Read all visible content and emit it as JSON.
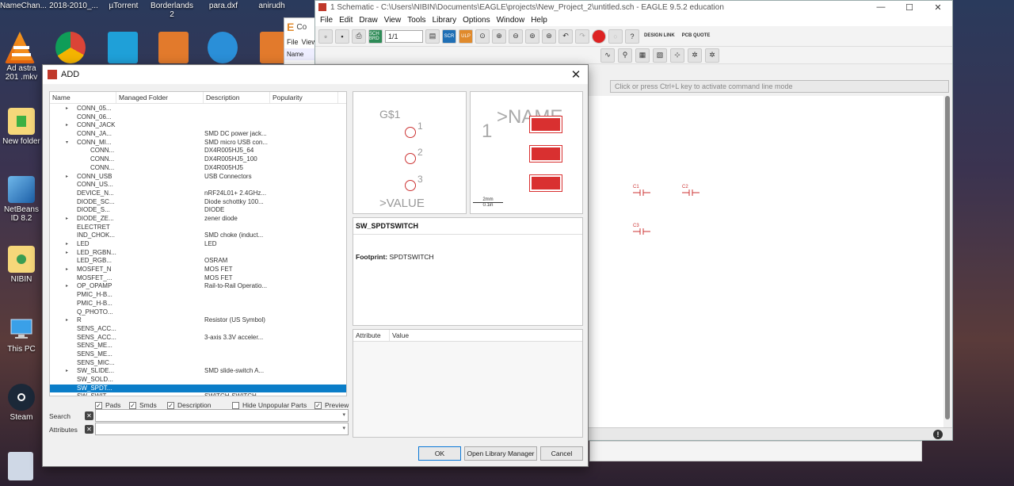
{
  "desktop": {
    "top_items": [
      {
        "label": "NameChan..."
      },
      {
        "label": "2018-2010_..."
      },
      {
        "label": "µTorrent"
      },
      {
        "label": "Borderlands 2"
      },
      {
        "label": "para.dxf"
      },
      {
        "label": "anirudh"
      }
    ],
    "left_icons": [
      {
        "label": "Ad astra 201 .mkv"
      },
      {
        "label": "New folder"
      },
      {
        "label": "NetBeans ID 8.2"
      },
      {
        "label": "NIBIN"
      },
      {
        "label": "This PC"
      },
      {
        "label": "Steam"
      }
    ]
  },
  "conwin": {
    "title": "Co",
    "file": "File",
    "view": "View",
    "name": "Name"
  },
  "eagle": {
    "title": "1 Schematic - C:\\Users\\NIBIN\\Documents\\EAGLE\\projects\\New_Project_2\\untitled.sch - EAGLE 9.5.2 education",
    "menu": [
      "File",
      "Edit",
      "Draw",
      "View",
      "Tools",
      "Library",
      "Options",
      "Window",
      "Help"
    ],
    "zoom": "1/1",
    "toolbar": {
      "sch": "SCH BRD",
      "scr": "SCR",
      "ulp": "ULP",
      "design_link": "DESIGN LINK",
      "pcb_quote": "PCB QUOTE"
    },
    "cmd_placeholder": "Click or press Ctrl+L key to activate command line mode",
    "caps": [
      "C1",
      "C2",
      "C3"
    ]
  },
  "dialog": {
    "title": "ADD",
    "columns": [
      "Name",
      "Managed Folder",
      "Description",
      "Popularity"
    ],
    "rows": [
      {
        "name": "CONN_05...",
        "desc": "",
        "arrow": "▸",
        "level": 1
      },
      {
        "name": "CONN_06...",
        "desc": "",
        "arrow": "",
        "level": 1
      },
      {
        "name": "CONN_JACK",
        "desc": "",
        "arrow": "▸",
        "level": 1
      },
      {
        "name": "CONN_JA...",
        "desc": "SMD DC power jack...",
        "arrow": "",
        "level": 1
      },
      {
        "name": "CONN_MI...",
        "desc": "SMD micro USB con...",
        "arrow": "▾",
        "level": 1
      },
      {
        "name": "CONN...",
        "desc": "DX4R005HJ5_64",
        "arrow": "",
        "level": 2
      },
      {
        "name": "CONN...",
        "desc": "DX4R005HJ5_100",
        "arrow": "",
        "level": 2
      },
      {
        "name": "CONN...",
        "desc": "DX4R005HJ5",
        "arrow": "",
        "level": 2
      },
      {
        "name": "CONN_USB",
        "desc": "USB Connectors",
        "arrow": "▸",
        "level": 1
      },
      {
        "name": "CONN_US...",
        "desc": "",
        "arrow": "",
        "level": 1
      },
      {
        "name": "DEVICE_N...",
        "desc": "nRF24L01+ 2.4GHz...",
        "arrow": "",
        "level": 1
      },
      {
        "name": "DIODE_SC...",
        "desc": "Diode schottky 100...",
        "arrow": "",
        "level": 1
      },
      {
        "name": "DIODE_S...",
        "desc": "DIODE",
        "arrow": "",
        "level": 1
      },
      {
        "name": "DIODE_ZE...",
        "desc": "zener diode",
        "arrow": "▸",
        "level": 1
      },
      {
        "name": "ELECTRET",
        "desc": "",
        "arrow": "",
        "level": 1
      },
      {
        "name": "IND_CHOK...",
        "desc": "SMD choke (induct...",
        "arrow": "",
        "level": 1
      },
      {
        "name": "LED",
        "desc": "LED",
        "arrow": "▸",
        "level": 1
      },
      {
        "name": "LED_RGBN...",
        "desc": "",
        "arrow": "▸",
        "level": 1
      },
      {
        "name": "LED_RGB...",
        "desc": "OSRAM",
        "arrow": "",
        "level": 1
      },
      {
        "name": "MOSFET_N",
        "desc": "MOS FET",
        "arrow": "▸",
        "level": 1
      },
      {
        "name": "MOSFET_...",
        "desc": "MOS FET",
        "arrow": "",
        "level": 1
      },
      {
        "name": "OP_OPAMP",
        "desc": "Rail-to-Rail Operatio...",
        "arrow": "▸",
        "level": 1
      },
      {
        "name": "PMIC_H-B...",
        "desc": "",
        "arrow": "",
        "level": 1
      },
      {
        "name": "PMIC_H-B...",
        "desc": "",
        "arrow": "",
        "level": 1
      },
      {
        "name": "Q_PHOTO...",
        "desc": "",
        "arrow": "",
        "level": 1
      },
      {
        "name": "R",
        "desc": "Resistor (US Symbol)",
        "arrow": "▸",
        "level": 1
      },
      {
        "name": "SENS_ACC...",
        "desc": "",
        "arrow": "",
        "level": 1
      },
      {
        "name": "SENS_ACC...",
        "desc": "3-axis 3.3V acceler...",
        "arrow": "",
        "level": 1
      },
      {
        "name": "SENS_ME...",
        "desc": "",
        "arrow": "",
        "level": 1
      },
      {
        "name": "SENS_ME...",
        "desc": "",
        "arrow": "",
        "level": 1
      },
      {
        "name": "SENS_MIC...",
        "desc": "",
        "arrow": "",
        "level": 1
      },
      {
        "name": "SW_SLIDE...",
        "desc": "SMD slide-switch A...",
        "arrow": "▸",
        "level": 1
      },
      {
        "name": "SW_SOLD...",
        "desc": "",
        "arrow": "",
        "level": 1
      },
      {
        "name": "SW_SPDT...",
        "desc": "",
        "arrow": "",
        "level": 1,
        "selected": true
      },
      {
        "name": "SW_SWIT...",
        "desc": "SWITCH-SWITCH",
        "arrow": "",
        "level": 1
      }
    ],
    "options": {
      "pads": "Pads",
      "smds": "Smds",
      "description": "Description",
      "hide_unpopular": "Hide Unpopular Parts",
      "preview": "Preview"
    },
    "search_label": "Search",
    "attributes_label": "Attributes",
    "symbol": {
      "gate": "G$1",
      "value": ">VALUE",
      "pins": [
        "1",
        "2",
        "3"
      ]
    },
    "package": {
      "name": ">NAME",
      "pin1": "1",
      "scale_top": "2mm",
      "scale_bottom": "0.1in"
    },
    "part_name": "SW_SPDTSWITCH",
    "footprint_label": "Footprint:",
    "footprint_value": "SPDTSWITCH",
    "attr_columns": [
      "Attribute",
      "Value"
    ],
    "buttons": {
      "ok": "OK",
      "library_manager": "Open Library Manager",
      "cancel": "Cancel"
    }
  }
}
